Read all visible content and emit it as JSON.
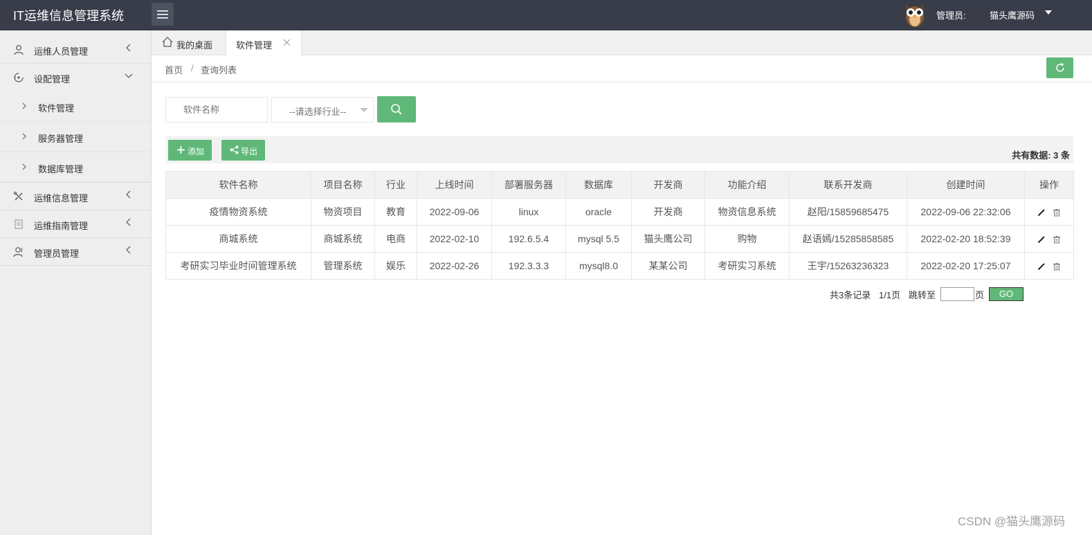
{
  "app": {
    "title": "IT运维信息管理系统",
    "admin_label": "管理员:",
    "admin_name": "猫头鹰源码"
  },
  "sidebar": {
    "items": [
      {
        "label": "运维人员管理",
        "icon": "user-icon"
      },
      {
        "label": "设配管理",
        "icon": "device-icon"
      },
      {
        "label": "软件管理",
        "icon": "chevron-right-icon"
      },
      {
        "label": "服务器管理",
        "icon": "chevron-right-icon"
      },
      {
        "label": "数据库管理",
        "icon": "chevron-right-icon"
      },
      {
        "label": "运维信息管理",
        "icon": "tools-icon"
      },
      {
        "label": "运维指南管理",
        "icon": "document-icon"
      },
      {
        "label": "管理员管理",
        "icon": "admin-icon"
      }
    ]
  },
  "tabs": [
    {
      "label": "我的桌面",
      "icon": "home-icon"
    },
    {
      "label": "软件管理",
      "icon": "close-icon"
    }
  ],
  "breadcrumb": {
    "home": "首页",
    "separator": "/",
    "current": "查询列表"
  },
  "search": {
    "name_placeholder": "软件名称",
    "industry_placeholder": "--请选择行业--"
  },
  "toolbar": {
    "add_label": "添加",
    "export_label": "导出",
    "total": "共有数据: 3 条"
  },
  "table": {
    "headers": [
      "软件名称",
      "项目名称",
      "行业",
      "上线时间",
      "部署服务器",
      "数据库",
      "开发商",
      "功能介绍",
      "联系开发商",
      "创建时间",
      "操作"
    ],
    "rows": [
      [
        "疫情物资系统",
        "物资项目",
        "教育",
        "2022-09-06",
        "linux",
        "oracle",
        "开发商",
        "物资信息系统",
        "赵阳/15859685475",
        "2022-09-06 22:32:06"
      ],
      [
        "商城系统",
        "商城系统",
        "电商",
        "2022-02-10",
        "192.6.5.4",
        "mysql 5.5",
        "猫头鹰公司",
        "购物",
        "赵语嫣/15285858585",
        "2022-02-20 18:52:39"
      ],
      [
        "考研实习毕业时间管理系统",
        "管理系统",
        "娱乐",
        "2022-02-26",
        "192.3.3.3",
        "mysql8.0",
        "某某公司",
        "考研实习系统",
        "王宇/15263236323",
        "2022-02-20 17:25:07"
      ]
    ]
  },
  "pager": {
    "records": "共3条记录",
    "pages": "1/1页",
    "jump_label": "跳转至",
    "page_unit": "页",
    "go_label": "GO"
  },
  "watermark": "CSDN @猫头鹰源码",
  "colors": {
    "header_bg": "#393d49",
    "accent_green": "#5fb878",
    "sidebar_bg": "#eeeeee"
  }
}
